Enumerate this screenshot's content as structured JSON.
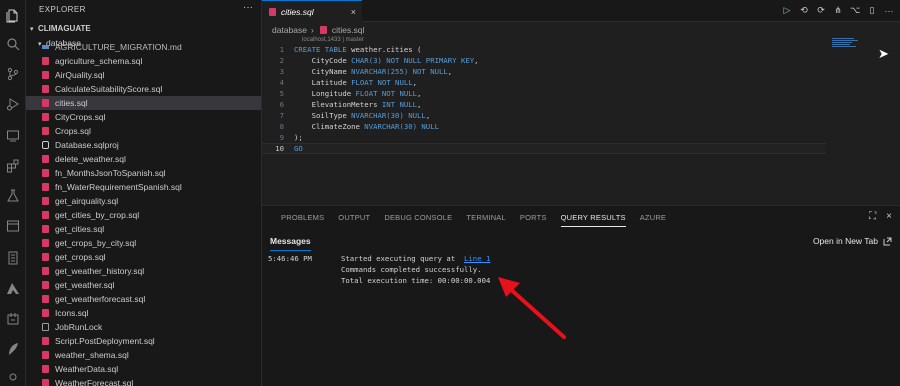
{
  "sidebar": {
    "title": "EXPLORER",
    "more": "···",
    "root": "CLIMAGUATE",
    "folder": "database",
    "cut_item": "AGRICULTURE_MIGRATION.md",
    "files": [
      {
        "name": "agriculture_schema.sql",
        "kind": "sql"
      },
      {
        "name": "AirQuality.sql",
        "kind": "sql"
      },
      {
        "name": "CalculateSuitabilityScore.sql",
        "kind": "sql"
      },
      {
        "name": "cities.sql",
        "kind": "sql",
        "active": true
      },
      {
        "name": "CityCrops.sql",
        "kind": "sql"
      },
      {
        "name": "Crops.sql",
        "kind": "sql"
      },
      {
        "name": "Database.sqlproj",
        "kind": "proj"
      },
      {
        "name": "delete_weather.sql",
        "kind": "sql"
      },
      {
        "name": "fn_MonthsJsonToSpanish.sql",
        "kind": "sql"
      },
      {
        "name": "fn_WaterRequirementSpanish.sql",
        "kind": "sql"
      },
      {
        "name": "get_airquality.sql",
        "kind": "sql"
      },
      {
        "name": "get_cities_by_crop.sql",
        "kind": "sql"
      },
      {
        "name": "get_cities.sql",
        "kind": "sql"
      },
      {
        "name": "get_crops_by_city.sql",
        "kind": "sql"
      },
      {
        "name": "get_crops.sql",
        "kind": "sql"
      },
      {
        "name": "get_weather_history.sql",
        "kind": "sql"
      },
      {
        "name": "get_weather.sql",
        "kind": "sql"
      },
      {
        "name": "get_weatherforecast.sql",
        "kind": "sql"
      },
      {
        "name": "Icons.sql",
        "kind": "sql"
      },
      {
        "name": "JobRunLock",
        "kind": "doc"
      },
      {
        "name": "Script.PostDeployment.sql",
        "kind": "sql"
      },
      {
        "name": "weather_shema.sql",
        "kind": "sql"
      },
      {
        "name": "WeatherData.sql",
        "kind": "sql"
      },
      {
        "name": "WeatherForecast.sql",
        "kind": "sql"
      }
    ]
  },
  "editor": {
    "tab_label": "cities.sql",
    "tab_close": "×",
    "breadcrumb_folder": "database",
    "breadcrumb_sep": "›",
    "breadcrumb_file": "cities.sql",
    "connection": "localhost,1433 | master",
    "lines": [
      {
        "n": "1",
        "kw": "CREATE TABLE ",
        "id": "weather.cities (",
        "kw2": "",
        "rest": ""
      },
      {
        "n": "2",
        "kw": "",
        "id": "    CityCode ",
        "kw2": "CHAR(3) NOT NULL PRIMARY KEY",
        "rest": ","
      },
      {
        "n": "3",
        "kw": "",
        "id": "    CityName ",
        "kw2": "NVARCHAR(255) NOT NULL",
        "rest": ","
      },
      {
        "n": "4",
        "kw": "",
        "id": "    Latitude ",
        "kw2": "FLOAT NOT NULL",
        "rest": ","
      },
      {
        "n": "5",
        "kw": "",
        "id": "    Longitude ",
        "kw2": "FLOAT NOT NULL",
        "rest": ","
      },
      {
        "n": "6",
        "kw": "",
        "id": "    ElevationMeters ",
        "kw2": "INT NULL",
        "rest": ","
      },
      {
        "n": "7",
        "kw": "",
        "id": "    SoilType ",
        "kw2": "NVARCHAR(30) NULL",
        "rest": ","
      },
      {
        "n": "8",
        "kw": "",
        "id": "    ClimateZone ",
        "kw2": "NVARCHAR(30) NULL",
        "rest": ""
      },
      {
        "n": "9",
        "kw": "",
        "id": ");",
        "kw2": "",
        "rest": ""
      },
      {
        "n": "10",
        "kw": "GO",
        "id": "",
        "kw2": "",
        "rest": ""
      }
    ]
  },
  "panel": {
    "tabs": [
      "PROBLEMS",
      "OUTPUT",
      "DEBUG CONSOLE",
      "TERMINAL",
      "PORTS",
      "QUERY RESULTS",
      "AZURE"
    ],
    "active_tab": "QUERY RESULTS",
    "messages_label": "Messages",
    "open_new_tab": "Open in New Tab",
    "time": "5:46:46 PM",
    "msg_started": "Started executing query at  ",
    "msg_link": "Line 1",
    "msg_completed": "Commands completed successfully.",
    "msg_total": "Total execution time: 00:00:00.004"
  },
  "icons": {
    "activity": [
      "files-icon",
      "search-icon",
      "source-control-icon",
      "run-debug-icon",
      "remote-explorer-icon",
      "extensions-icon",
      "testing-icon",
      "database-icon",
      "sql-projects-icon",
      "azure-icon",
      "docker-icon",
      "ai-toolkit-icon"
    ],
    "toolbar": [
      "run-icon",
      "connect-icon",
      "refresh-icon",
      "estimated-plan-icon",
      "query-plan-icon",
      "split-editor-icon",
      "more-actions-icon"
    ]
  },
  "colors": {
    "accent": "#0078d4",
    "sql_icon": "#d63a64",
    "keyword": "#569cd6",
    "link": "#3794ff",
    "annotation_arrow": "#e8101a"
  }
}
